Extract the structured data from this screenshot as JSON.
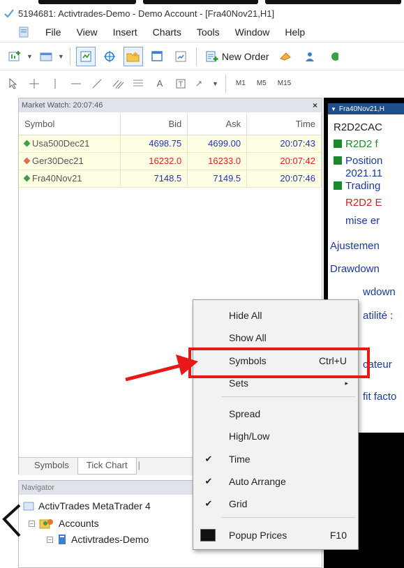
{
  "window": {
    "title": "5194681: Activtrades-Demo - Demo Account - [Fra40Nov21,H1]"
  },
  "menu": [
    "File",
    "View",
    "Insert",
    "Charts",
    "Tools",
    "Window",
    "Help"
  ],
  "toolbar": {
    "new_order_label": "New Order",
    "timeframes": [
      "M1",
      "M5",
      "M15"
    ]
  },
  "market_watch": {
    "title": "Market Watch: 20:07:46",
    "close_label": "×",
    "columns": [
      "Symbol",
      "Bid",
      "Ask",
      "Time"
    ],
    "rows": [
      {
        "symbol": "Usa500Dec21",
        "bid": "4698.75",
        "ask": "4699.00",
        "time": "20:07:43",
        "color": "#2130c8",
        "icon_color": "#3aa04a"
      },
      {
        "symbol": "Ger30Dec21",
        "bid": "16232.0",
        "ask": "16233.0",
        "time": "20:07:42",
        "color": "#e02020",
        "icon_color": "#e07050"
      },
      {
        "symbol": "Fra40Nov21",
        "bid": "7148.5",
        "ask": "7149.5",
        "time": "20:07:46",
        "color": "#2130c8",
        "icon_color": "#3aa04a"
      }
    ],
    "tabs": [
      "Symbols",
      "Tick Chart"
    ]
  },
  "navigator": {
    "title": "Navigator",
    "items": [
      "ActivTrades MetaTrader 4",
      "Accounts",
      "Activtrades-Demo"
    ]
  },
  "chart": {
    "header": "Fra40Nov21,H",
    "lines": [
      "R2D2CAC",
      "R2D2 f",
      "Position",
      "2021.11",
      "Trading",
      "R2D2 E",
      "mise er",
      "Ajustemen",
      "Drawdown",
      "wdown",
      "atilité :",
      "cateur",
      "fit facto"
    ]
  },
  "context_menu": {
    "items": [
      {
        "label": "Hide All"
      },
      {
        "label": "Show All"
      },
      {
        "label": "Symbols",
        "shortcut": "Ctrl+U"
      },
      {
        "label": "Sets",
        "submenu": "▸"
      },
      {
        "label": "Spread"
      },
      {
        "label": "High/Low"
      },
      {
        "label": "Time",
        "checked": "✔"
      },
      {
        "label": "Auto Arrange",
        "checked": "✔"
      },
      {
        "label": "Grid",
        "checked": "✔"
      },
      {
        "label": "Popup Prices",
        "shortcut": "F10"
      }
    ]
  },
  "annotation": {
    "highlight_color": "#e81818"
  }
}
